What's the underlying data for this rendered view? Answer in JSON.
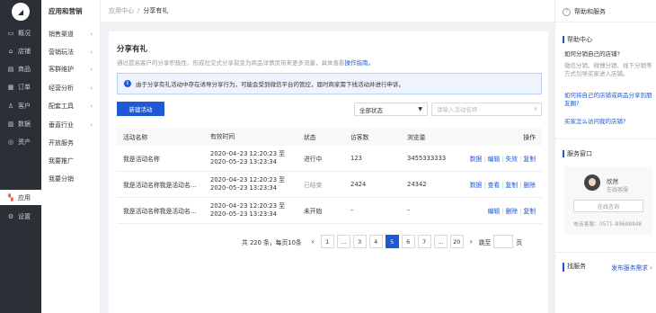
{
  "nav_primary": {
    "logo_glyph": "◢",
    "items": [
      {
        "icon": "overview-icon",
        "glyph": "▭",
        "label": "概况"
      },
      {
        "icon": "store-icon",
        "glyph": "⌂",
        "label": "店铺"
      },
      {
        "icon": "goods-icon",
        "glyph": "▤",
        "label": "商品"
      },
      {
        "icon": "order-icon",
        "glyph": "▦",
        "label": "订单"
      },
      {
        "icon": "customer-icon",
        "glyph": "♙",
        "label": "客户"
      },
      {
        "icon": "data-icon",
        "glyph": "▥",
        "label": "数据"
      },
      {
        "icon": "asset-icon",
        "glyph": "◎",
        "label": "资产"
      },
      {
        "icon": "apps-icon",
        "glyph": "▚",
        "label": "应用"
      },
      {
        "icon": "settings-icon",
        "glyph": "⚙",
        "label": "设置"
      }
    ]
  },
  "nav_secondary": {
    "title": "应用和营销",
    "items": [
      {
        "label": "销售渠道",
        "chev": "›"
      },
      {
        "label": "营销玩法",
        "chev": "›"
      },
      {
        "label": "客群维护",
        "chev": "›"
      },
      {
        "label": "经营分析",
        "chev": "›"
      },
      {
        "label": "配套工具",
        "chev": "›"
      },
      {
        "label": "垂直行业",
        "chev": "›"
      },
      {
        "label": "开放服务",
        "chev": ""
      },
      {
        "label": "我要推广",
        "chev": ""
      },
      {
        "label": "我要分销",
        "chev": ""
      }
    ]
  },
  "breadcrumb": {
    "parent": "应用中心",
    "sep": "/",
    "current": "分享有礼"
  },
  "main": {
    "title": "分享有礼",
    "desc": "通过提高客户的分享积极性，形成社交式分享裂变为商品详情页带来更多流量，具体查看",
    "desc_link": "操作指南。",
    "notice_icon": "i",
    "notice": "由于分享有礼活动中存在诱导分享行为，可能会受到微信平台的管控，届时商家需下线活动并进行申诉。",
    "new_button": "新建活动",
    "status_select": "全部状态",
    "select_arrow": "▼",
    "search_placeholder": "请输入活动名称",
    "search_glyph": "⌕"
  },
  "table": {
    "headers": [
      "活动名称",
      "有效时间",
      "状态",
      "访客数",
      "浏览量",
      "操作"
    ],
    "rows": [
      {
        "name": "我是活动名称",
        "time1": "2020–04–23 12:20:23 至",
        "time2": "2020–05–23 13:23:34",
        "status": "进行中",
        "visitors": "123",
        "views": "3455333333",
        "ops": [
          "数据",
          "编辑",
          "失效",
          "复制"
        ]
      },
      {
        "name": "我是活动名称我是活动名…",
        "time1": "2020–04–23 12:20:23 至",
        "time2": "2020–05–23 13:23:34",
        "status": "已结束",
        "visitors": "2424",
        "views": "24342",
        "ops": [
          "数据",
          "查看",
          "复制",
          "删除"
        ]
      },
      {
        "name": "我是活动名称我是活动名…",
        "time1": "2020–04–23 12:20:23 至",
        "time2": "2020–05–23 13:23:34",
        "status": "未开始",
        "visitors": "–",
        "views": "–",
        "ops": [
          "编辑",
          "删除",
          "复制"
        ]
      }
    ]
  },
  "pagination": {
    "total": "共 220 条，每页10条",
    "prev": "‹",
    "next": "›",
    "pages": [
      "1",
      "...",
      "3",
      "4",
      "5",
      "6",
      "7",
      "...",
      "20"
    ],
    "active": "5",
    "jump_label": "跳至",
    "page_suffix": "页"
  },
  "help": {
    "q_glyph": "?",
    "title": "帮助和服务",
    "center_title": "帮助中心",
    "q1": "如何分销自己的店铺?",
    "q1_answer": "微信分销、微博分销、线下分销等方式引导买家进入店铺。",
    "link1": "如何将自己的店铺或商品分享到朋友圈?",
    "link2": "买家怎么访问我的店铺?",
    "service_title": "服务窗口",
    "agent_name": "欣然",
    "agent_status": "在线客服",
    "consult_button": "在线咨询",
    "phone": "电话客服：0571–89688848",
    "find_service": "找服务",
    "post_demand": "发布服务需求 ›"
  },
  "colors": {
    "accent": "#1d58d5",
    "nav_dark": "#2c2f36",
    "active_icon": "#e85a3c"
  }
}
